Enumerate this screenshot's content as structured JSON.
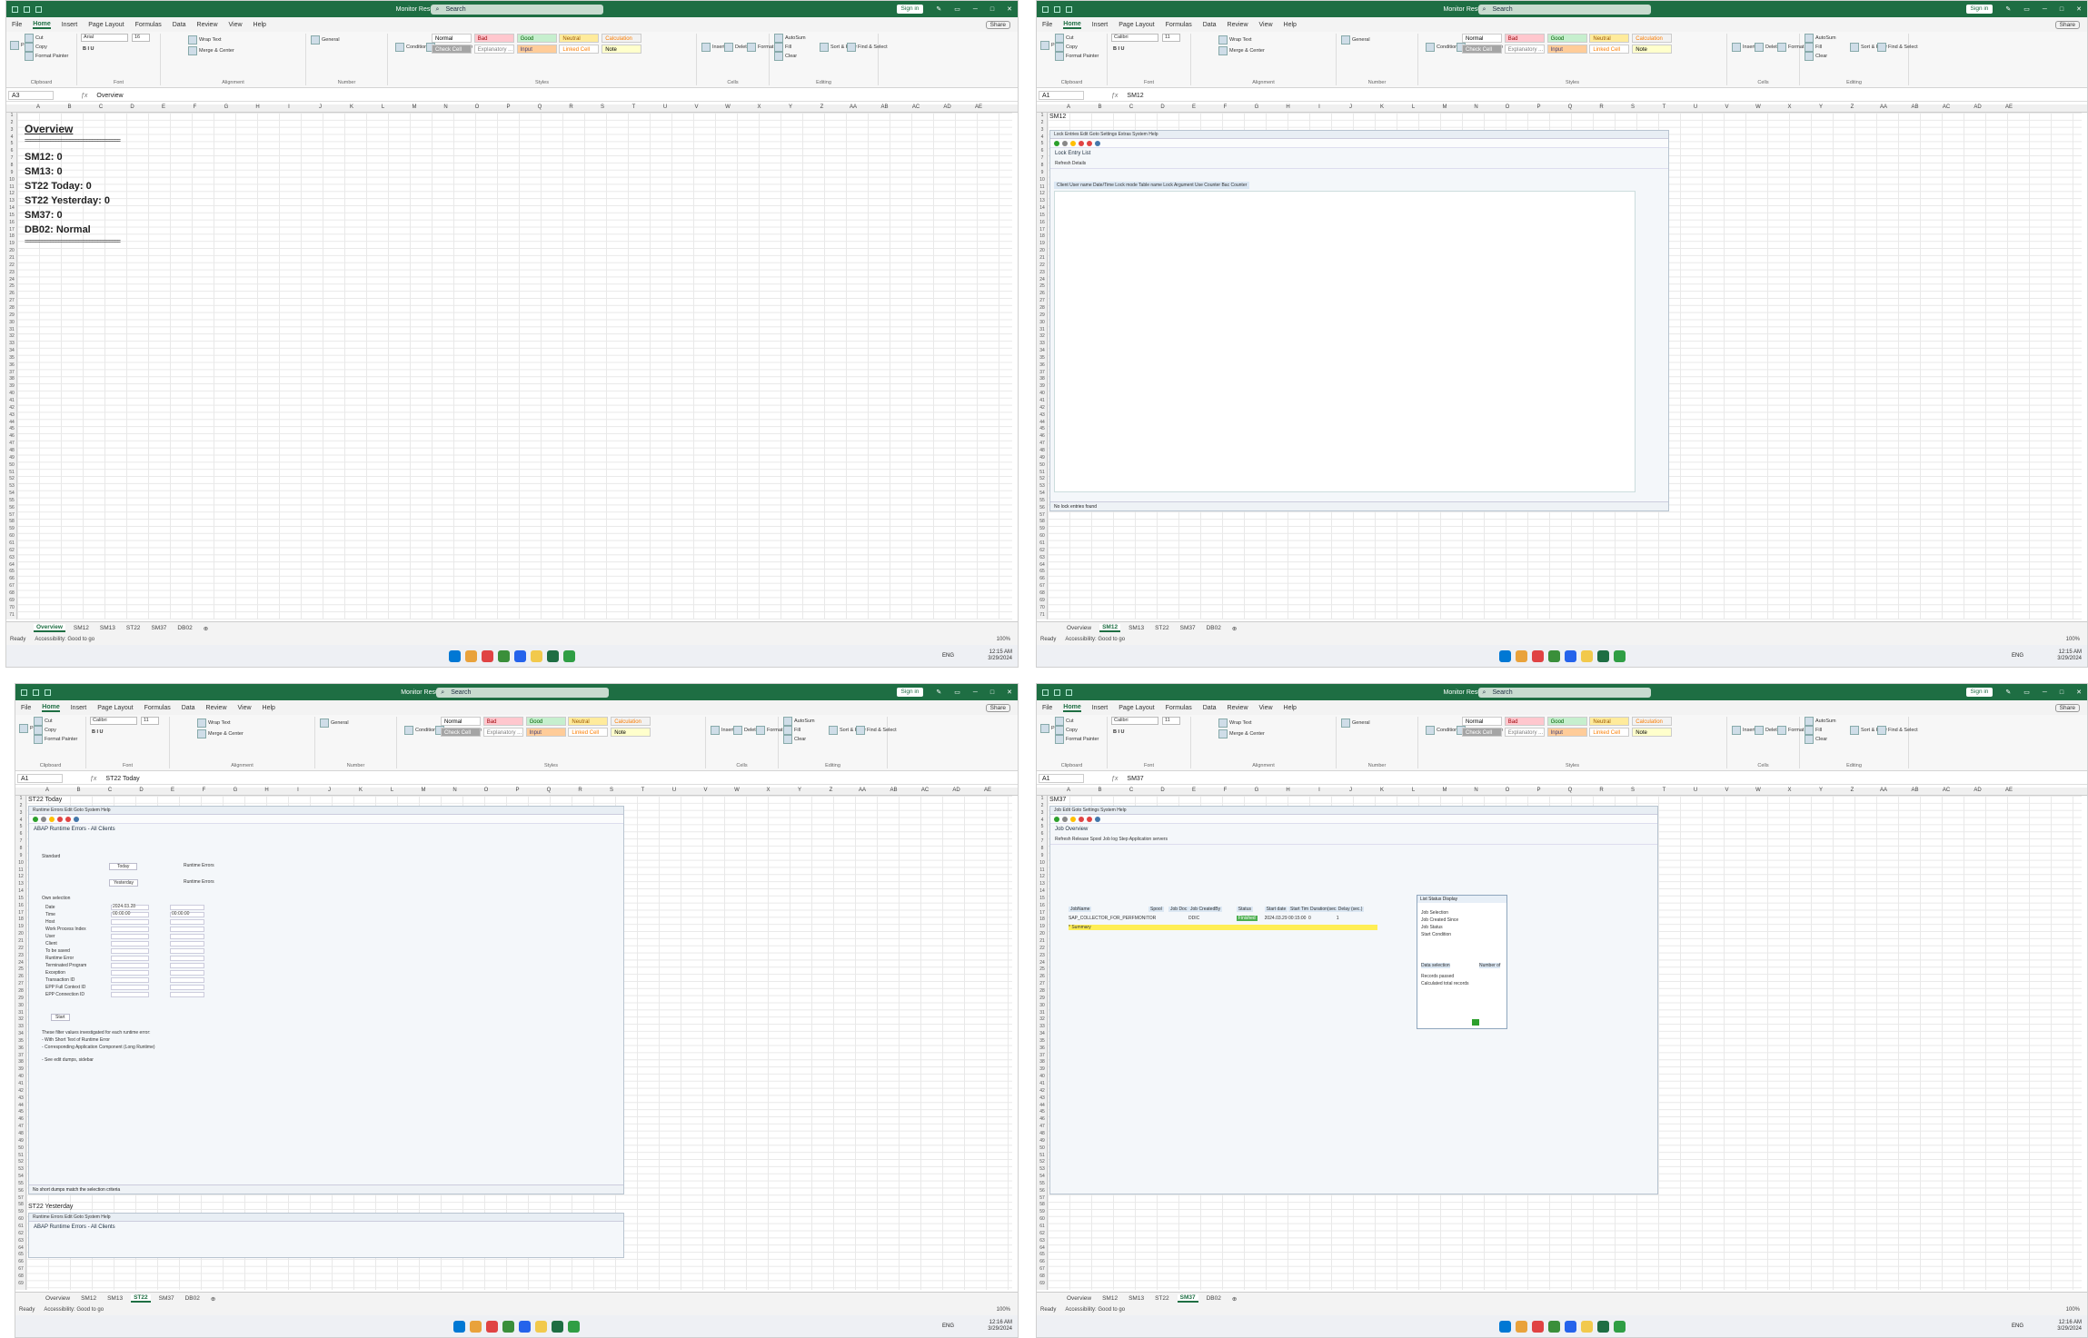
{
  "excel": {
    "filename": "Monitor Result_2024-03-29.xlsx - Excel",
    "search": "Search",
    "signin": "Sign in",
    "share": "Share",
    "menus": [
      "File",
      "Home",
      "Insert",
      "Page Layout",
      "Formulas",
      "Data",
      "Review",
      "View",
      "Help"
    ],
    "clipboard": {
      "paste": "Paste",
      "cut": "Cut",
      "copy": "Copy",
      "painter": "Format Painter",
      "label": "Clipboard"
    },
    "font_label": "Font",
    "alignment_label": "Alignment",
    "number_label": "Number",
    "styles_label": "Styles",
    "cells_label": "Cells",
    "editing_label": "Editing",
    "wrap": "Wrap Text",
    "merge": "Merge & Center",
    "general": "General",
    "cond": "Conditional Formatting",
    "fmt_table": "Format as Table",
    "styles": {
      "normal": "Normal",
      "bad": "Bad",
      "good": "Good",
      "neutral": "Neutral",
      "calc": "Calculation",
      "check": "Check Cell",
      "expl": "Explanatory ...",
      "input": "Input",
      "linked": "Linked Cell",
      "note": "Note"
    },
    "insert": "Insert",
    "delete": "Delete",
    "format": "Format",
    "autosum": "AutoSum",
    "fill": "Fill",
    "clear": "Clear",
    "sort": "Sort & Filter",
    "find": "Find & Select",
    "columns": [
      "A",
      "B",
      "C",
      "D",
      "E",
      "F",
      "G",
      "H",
      "I",
      "J",
      "K",
      "L",
      "M",
      "N",
      "O",
      "P",
      "Q",
      "R",
      "S",
      "T",
      "U",
      "V",
      "W",
      "X",
      "Y",
      "Z",
      "AA",
      "AB",
      "AC",
      "AD",
      "AE"
    ],
    "sheet_tabs": [
      "Overview",
      "SM12",
      "SM13",
      "ST22",
      "SM37",
      "DB02"
    ],
    "status_ready": "Ready",
    "status_access": "Accessibility: Good to go",
    "zoom": "100%",
    "lang": "ENG"
  },
  "q1": {
    "font": "Arial",
    "size": "16",
    "namebox": "A3",
    "formula": "Overview",
    "time": "12:15 AM",
    "date": "3/29/2024",
    "overview_title": "Overview",
    "dashes": "==================================",
    "lines": [
      "SM12: 0",
      "SM13: 0",
      "ST22 Today: 0",
      "ST22 Yesterday: 0",
      "SM37: 0",
      "DB02: Normal"
    ],
    "active_tab": "Overview"
  },
  "q2": {
    "font": "Calibri",
    "size": "11",
    "namebox": "A1",
    "formula": "SM12",
    "time": "12:15 AM",
    "date": "3/29/2024",
    "a1": "SM12",
    "sap_menu": "Lock Entries  Edit  Goto  Settings  Extras  System  Help",
    "sap_title": "Lock Entry List",
    "sap_tools": "Refresh   Details",
    "sap_cols": "Client  User name  Date/Time  Lock mode  Table name  Lock Argument  Use Counter  Bac Counter",
    "sap_status": "No lock entries found",
    "active_tab": "SM12"
  },
  "q3": {
    "font": "Calibri",
    "size": "11",
    "namebox": "A1",
    "formula": "ST22 Today",
    "time": "12:16 AM",
    "date": "3/29/2024",
    "a1": "ST22 Today",
    "a40": "ST22 Yesterday",
    "sap_menu": "Runtime Errors  Edit  Goto  System  Help",
    "sap_title": "ABAP Runtime Errors - All Clients",
    "standard": "Standard",
    "today": "Today",
    "yesterday": "Yesterday",
    "rt": "Runtime Errors",
    "own_sel": "Own selection",
    "fields": [
      "Date",
      "Time",
      "Host",
      "Work Process Index",
      "User",
      "Client",
      "To be saved",
      "Runtime Error",
      "Terminated Program",
      "Exception",
      "Transaction ID",
      "EPP Full Context ID",
      "EPP Connection ID"
    ],
    "date_val": "2024.03.28",
    "time_val": "00:00:00",
    "to_time": "00:00:00",
    "start": "Start",
    "note1": "These filter values investigated for each runtime error:",
    "note2": "- With Short Text of Runtime Error",
    "note3": "- Corresponding Application Component (Long Runtime)",
    "note4": "- See edit dumps, sidebar",
    "sap_status": "No short dumps match the selection criteria",
    "active_tab": "ST22"
  },
  "q4": {
    "font": "Calibri",
    "size": "11",
    "namebox": "A1",
    "formula": "SM37",
    "time": "12:16 AM",
    "date": "3/29/2024",
    "a1": "SM37",
    "sap_menu": "Job  Edit  Goto  Settings  System  Help",
    "sap_title": "Job Overview",
    "sap_tools": "Refresh   Release   Spool   Job log   Step   Application servers",
    "job_cols": [
      "JobName",
      "Spool",
      "Job Doc",
      "Job CreatedBy",
      "Status",
      "Start date",
      "Start Time",
      "Duration(sec.)",
      "Delay (sec.)"
    ],
    "job_row": [
      "SAP_COLLECTOR_FOR_PERFMONITOR",
      "",
      "",
      "DDIC",
      "Finished",
      "2024.03.29",
      "00:15:00",
      "0",
      "1"
    ],
    "job_sum": "* Summary",
    "popup_title": "List Status Display",
    "popup_rows": [
      "Job Selection",
      "Job Created Since",
      "Job Status",
      "Start Condition"
    ],
    "popup_lbl": "Data selection",
    "popup_val": "Number of",
    "popup_r1": "Records passed",
    "popup_r2": "Calculated total records",
    "active_tab": "SM37"
  }
}
